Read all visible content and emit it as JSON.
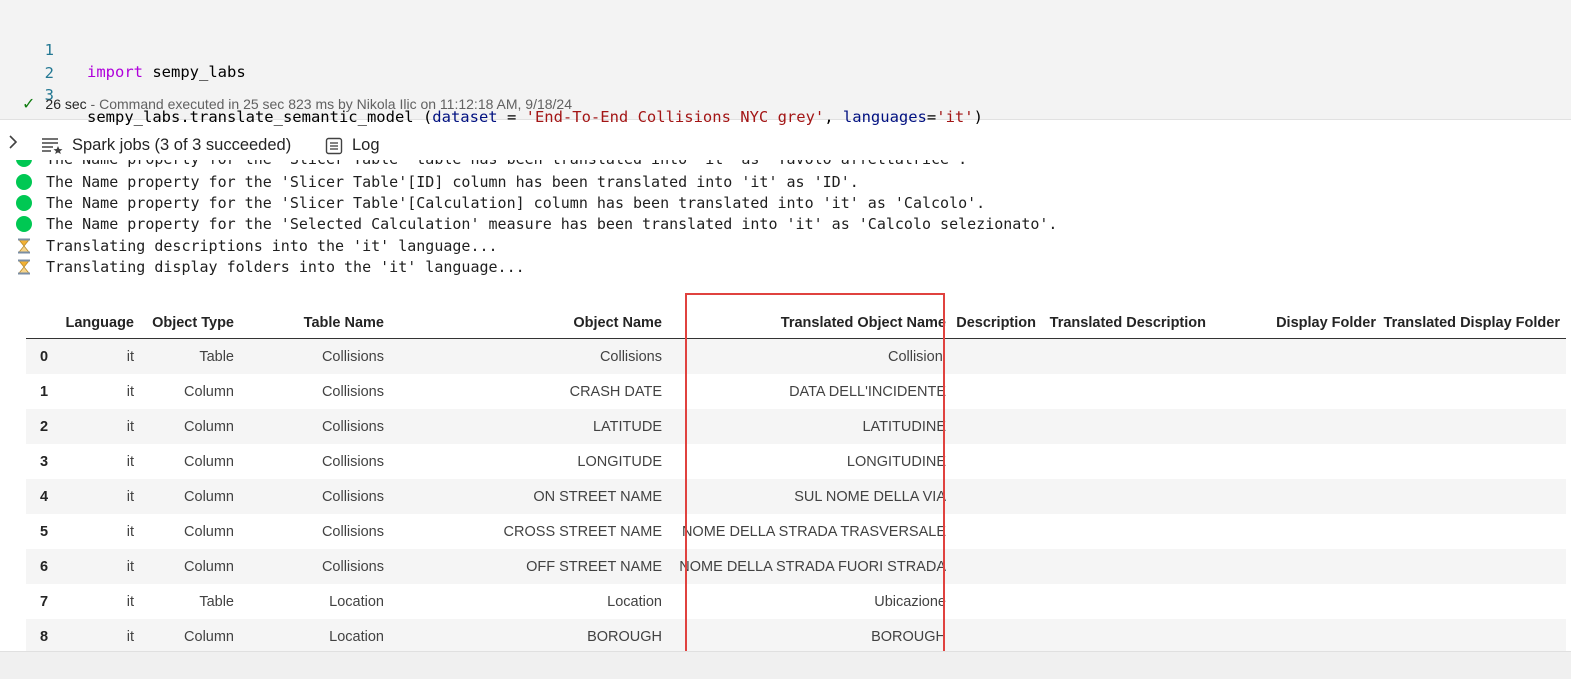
{
  "code_cell": {
    "lines": [
      {
        "num": "1",
        "keyword": "import",
        "rest": " sempy_labs"
      },
      {
        "num": "2"
      },
      {
        "num": "3",
        "fn": "sempy_labs.translate_semantic_model (",
        "p1": "dataset",
        "eq1": " = ",
        "s1": "'End-To-End Collisions NYC grey'",
        "comma": ", ",
        "p2": "languages",
        "eq2": "=",
        "s2": "'it'",
        "close": ")"
      }
    ],
    "status_duration": "26 sec",
    "status_text": " - Command executed in 25 sec 823 ms by Nikola Ilic on 11:12:18 AM, 9/18/24"
  },
  "toolbar": {
    "spark_jobs_label": "Spark jobs (3 of 3 succeeded)",
    "log_label": "Log"
  },
  "output_log": {
    "cut_line": "The Name property for the 'Slicer Table' table has been translated into 'it' as 'Tavolo affettatrice'.",
    "lines": [
      "The Name property for the 'Slicer Table'[ID] column has been translated into 'it' as 'ID'.",
      "The Name property for the 'Slicer Table'[Calculation] column has been translated into 'it' as 'Calcolo'.",
      "The Name property for the 'Selected Calculation' measure has been translated into 'it' as 'Calcolo selezionato'."
    ],
    "progress_lines": [
      "Translating descriptions into the 'it' language...",
      "Translating display folders into the 'it' language..."
    ],
    "success_color": "#00c853"
  },
  "table": {
    "columns": [
      "Language",
      "Object Type",
      "Table Name",
      "Object Name",
      "Translated Object Name",
      "Description",
      "Translated Description",
      "Display Folder",
      "Translated Display Folder"
    ],
    "rows": [
      [
        "0",
        "it",
        "Table",
        "Collisions",
        "Collisions",
        "Collisioni",
        "",
        "",
        "",
        ""
      ],
      [
        "1",
        "it",
        "Column",
        "Collisions",
        "CRASH DATE",
        "DATA DELL'INCIDENTE",
        "",
        "",
        "",
        ""
      ],
      [
        "2",
        "it",
        "Column",
        "Collisions",
        "LATITUDE",
        "LATITUDINE",
        "",
        "",
        "",
        ""
      ],
      [
        "3",
        "it",
        "Column",
        "Collisions",
        "LONGITUDE",
        "LONGITUDINE",
        "",
        "",
        "",
        ""
      ],
      [
        "4",
        "it",
        "Column",
        "Collisions",
        "ON STREET NAME",
        "SUL NOME DELLA VIA",
        "",
        "",
        "",
        ""
      ],
      [
        "5",
        "it",
        "Column",
        "Collisions",
        "CROSS STREET NAME",
        "NOME DELLA STRADA TRASVERSALE",
        "",
        "",
        "",
        ""
      ],
      [
        "6",
        "it",
        "Column",
        "Collisions",
        "OFF STREET NAME",
        "NOME DELLA STRADA FUORI STRADA",
        "",
        "",
        "",
        ""
      ],
      [
        "7",
        "it",
        "Table",
        "Location",
        "Location",
        "Ubicazione",
        "",
        "",
        "",
        ""
      ],
      [
        "8",
        "it",
        "Column",
        "Location",
        "BOROUGH",
        "BOROUGH",
        "",
        "",
        "",
        ""
      ]
    ],
    "highlight_color": "#e0423f"
  }
}
